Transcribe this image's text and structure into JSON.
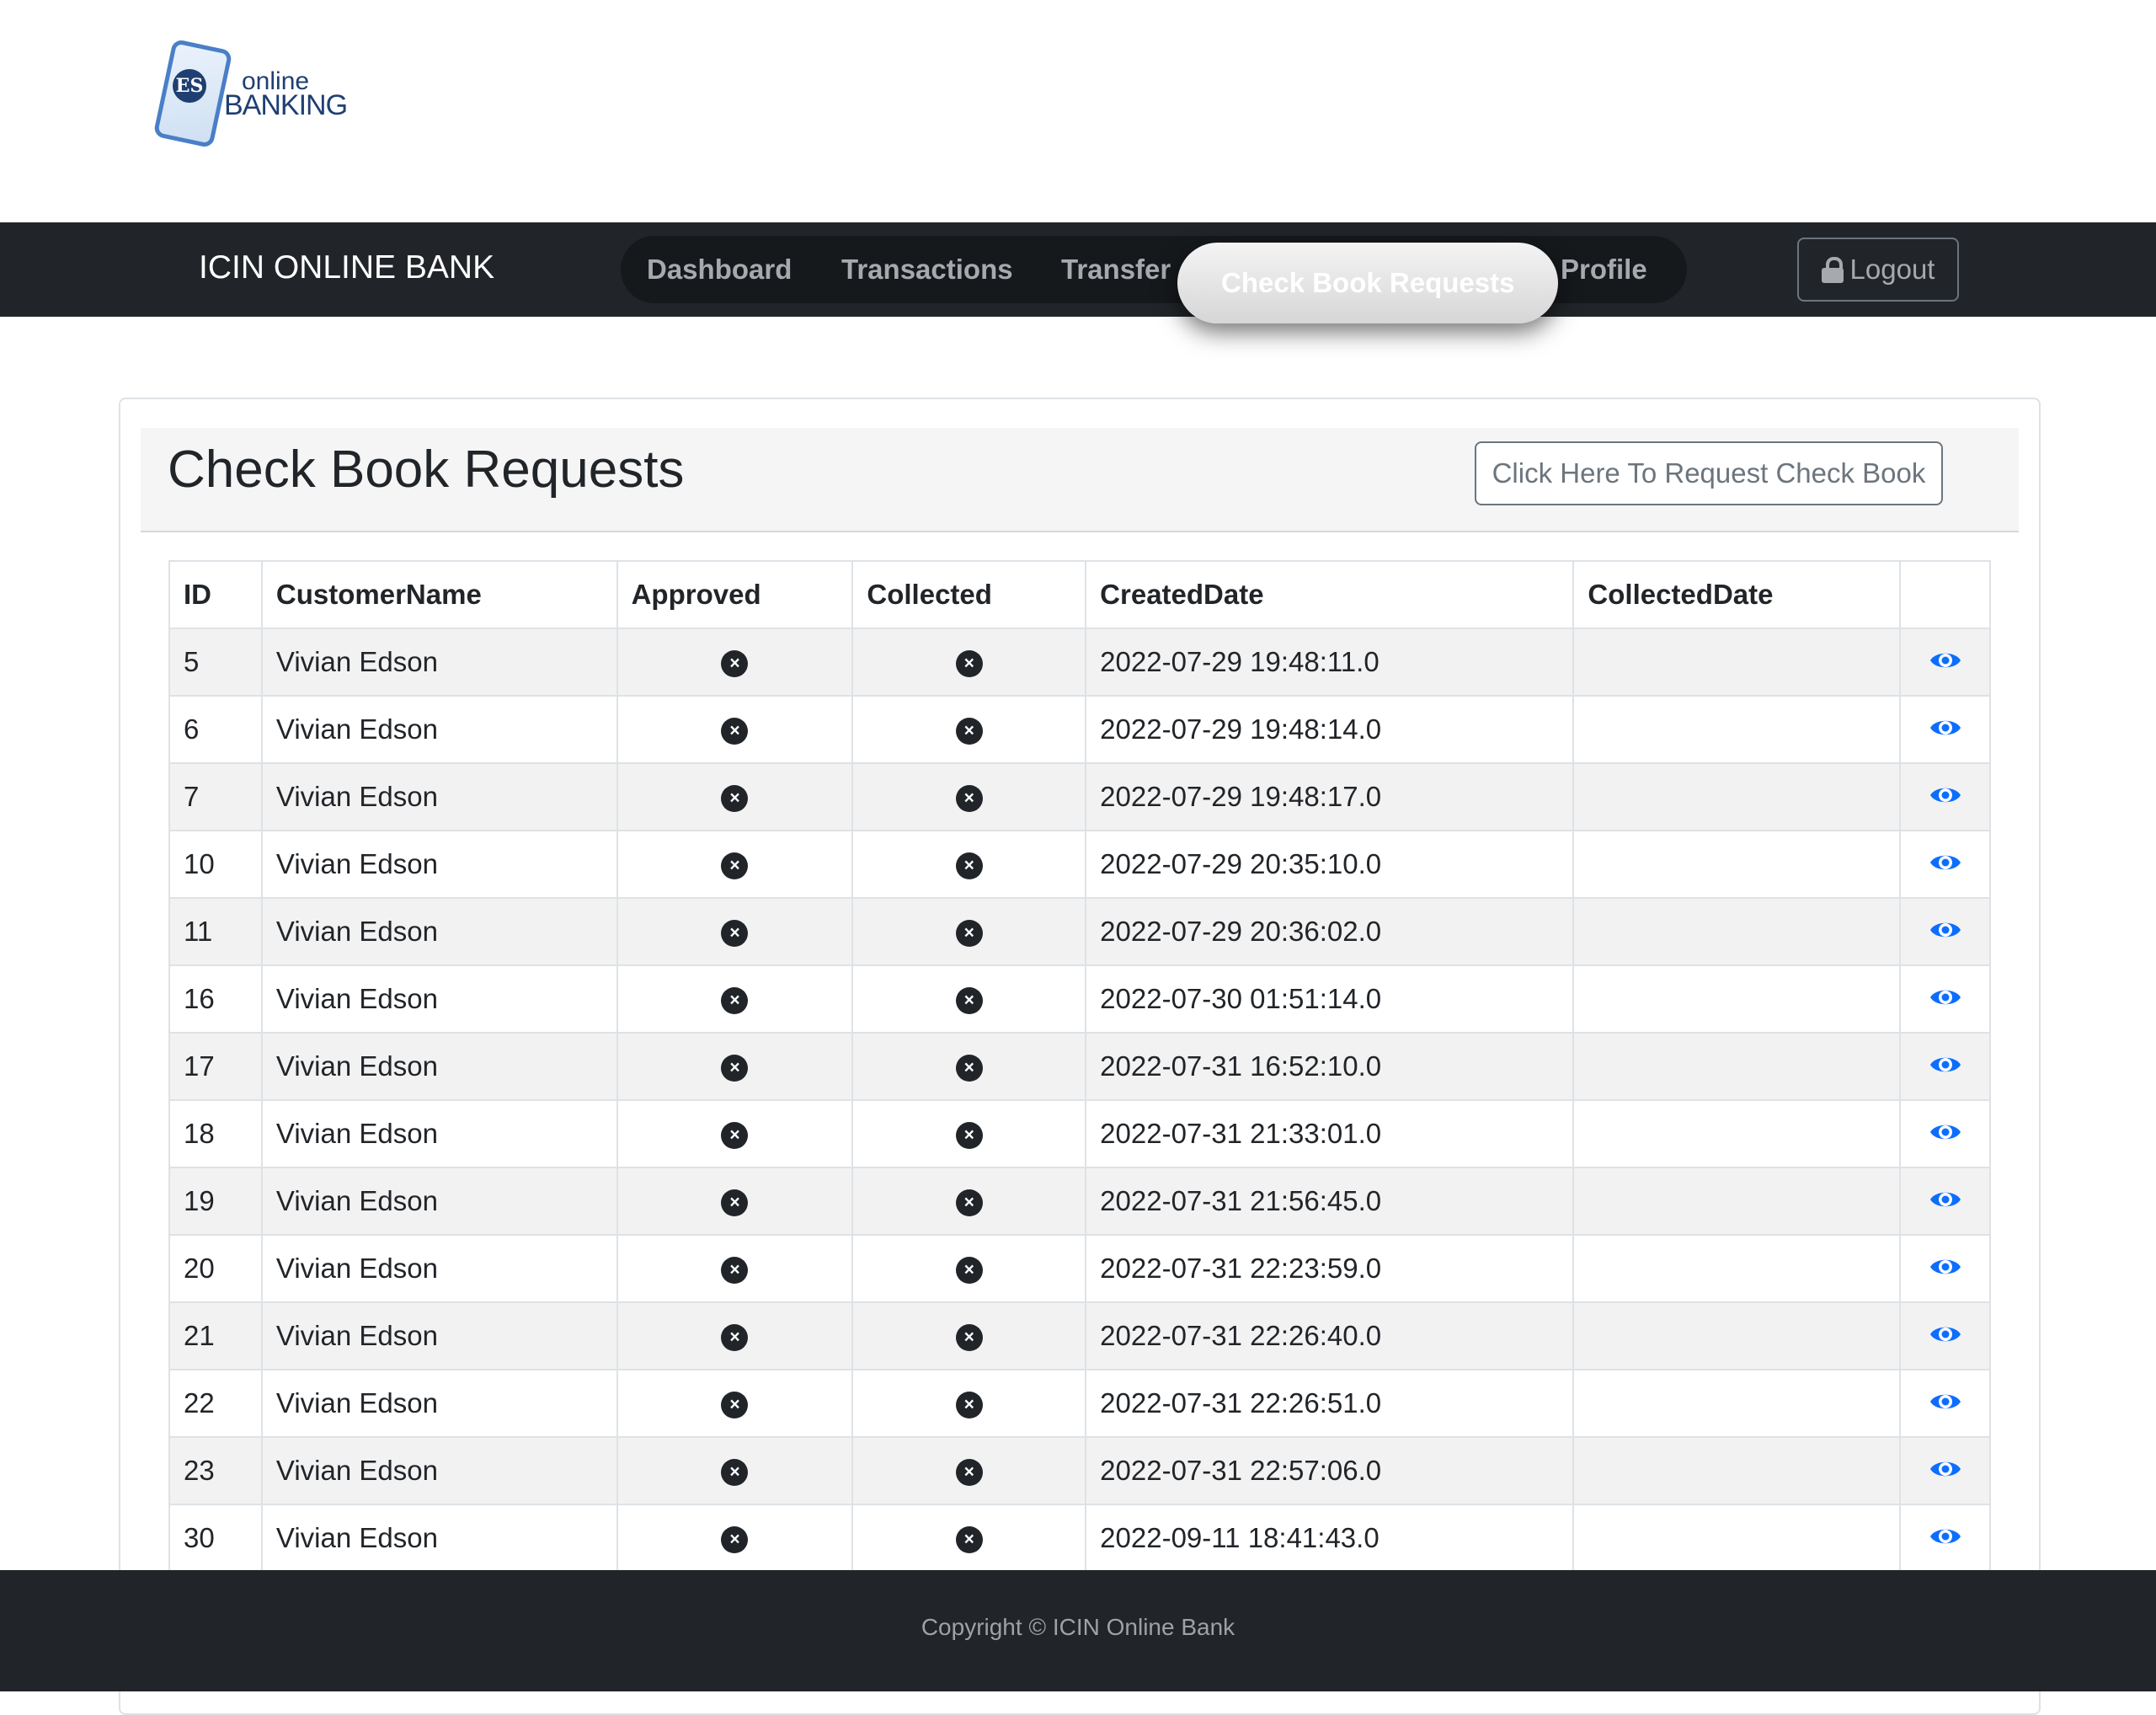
{
  "logo": {
    "monogram": "ES",
    "line1": "online",
    "line2": "BANKING"
  },
  "navbar": {
    "brand": "ICIN ONLINE BANK",
    "links": [
      "Dashboard",
      "Transactions",
      "Transfer",
      "Check Book Requests",
      "Profile"
    ],
    "active": "Check Book Requests",
    "logout_label": "Logout"
  },
  "page": {
    "title": "Check Book Requests",
    "request_button": "Click Here To Request Check Book"
  },
  "table": {
    "columns": [
      "ID",
      "CustomerName",
      "Approved",
      "Collected",
      "CreatedDate",
      "CollectedDate",
      ""
    ],
    "rows": [
      {
        "id": "5",
        "name": "Vivian Edson",
        "created": "2022-07-29 19:48:11.0",
        "collected_date": ""
      },
      {
        "id": "6",
        "name": "Vivian Edson",
        "created": "2022-07-29 19:48:14.0",
        "collected_date": ""
      },
      {
        "id": "7",
        "name": "Vivian Edson",
        "created": "2022-07-29 19:48:17.0",
        "collected_date": ""
      },
      {
        "id": "10",
        "name": "Vivian Edson",
        "created": "2022-07-29 20:35:10.0",
        "collected_date": ""
      },
      {
        "id": "11",
        "name": "Vivian Edson",
        "created": "2022-07-29 20:36:02.0",
        "collected_date": ""
      },
      {
        "id": "16",
        "name": "Vivian Edson",
        "created": "2022-07-30 01:51:14.0",
        "collected_date": ""
      },
      {
        "id": "17",
        "name": "Vivian Edson",
        "created": "2022-07-31 16:52:10.0",
        "collected_date": ""
      },
      {
        "id": "18",
        "name": "Vivian Edson",
        "created": "2022-07-31 21:33:01.0",
        "collected_date": ""
      },
      {
        "id": "19",
        "name": "Vivian Edson",
        "created": "2022-07-31 21:56:45.0",
        "collected_date": ""
      },
      {
        "id": "20",
        "name": "Vivian Edson",
        "created": "2022-07-31 22:23:59.0",
        "collected_date": ""
      },
      {
        "id": "21",
        "name": "Vivian Edson",
        "created": "2022-07-31 22:26:40.0",
        "collected_date": ""
      },
      {
        "id": "22",
        "name": "Vivian Edson",
        "created": "2022-07-31 22:26:51.0",
        "collected_date": ""
      },
      {
        "id": "23",
        "name": "Vivian Edson",
        "created": "2022-07-31 22:57:06.0",
        "collected_date": ""
      },
      {
        "id": "30",
        "name": "Vivian Edson",
        "created": "2022-09-11 18:41:43.0",
        "collected_date": ""
      }
    ],
    "approved_icon": "x-circle-icon",
    "collected_icon": "x-circle-icon",
    "action_icon": "eye-icon"
  },
  "footer": {
    "copyright": "Copyright © ICIN Online Bank"
  },
  "colors": {
    "navbar": "#212529",
    "accent": "#0d6efd",
    "footer": "#212529"
  }
}
